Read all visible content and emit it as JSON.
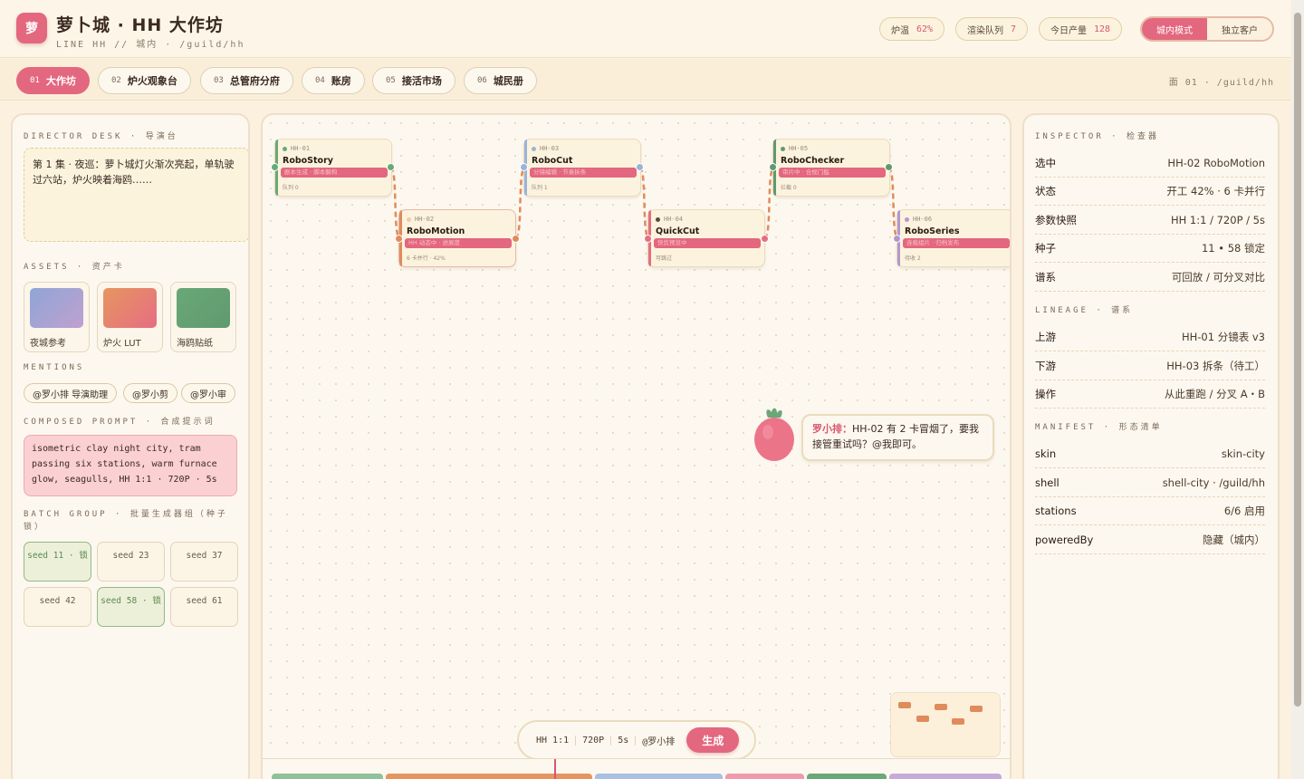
{
  "header": {
    "logo": "萝",
    "title": "萝卜城 · HH 大作坊",
    "subtitle": "LINE HH // 城内 · /guild/hh",
    "stats": [
      {
        "label": "炉温",
        "value": "62%"
      },
      {
        "label": "渲染队列",
        "value": "7"
      },
      {
        "label": "今日产量",
        "value": "128"
      }
    ],
    "mode_on": "城内模式",
    "mode_off": "独立客户"
  },
  "tabs": [
    {
      "num": "01",
      "label": "大作坊"
    },
    {
      "num": "02",
      "label": "炉火观象台"
    },
    {
      "num": "03",
      "label": "总管府分府"
    },
    {
      "num": "04",
      "label": "账房"
    },
    {
      "num": "05",
      "label": "接活市场"
    },
    {
      "num": "06",
      "label": "城民册"
    }
  ],
  "tabs_right": "面 01 · /guild/hh",
  "director": {
    "section": "DIRECTOR DESK · 导演台",
    "text": "第 1 集 · 夜巡：萝卜城灯火渐次亮起，单轨驶过六站，炉火映着海鸥……",
    "assets_section": "ASSETS · 资产卡",
    "assets": [
      {
        "label": "夜城参考",
        "color1": "#8fa6d6",
        "color2": "#bfa0d0"
      },
      {
        "label": "炉火 LUT",
        "color1": "#e79560",
        "color2": "#e56e82"
      },
      {
        "label": "海鸥贴纸",
        "color1": "#6aa877",
        "color2": "#5f9a6e"
      }
    ],
    "mentions_section": "MENTIONS",
    "mentions": [
      "@罗小排 导演助理",
      "@罗小剪",
      "@罗小审"
    ],
    "prompt_section": "COMPOSED PROMPT · 合成提示词",
    "prompt": "isometric clay night city, tram passing six stations, warm furnace glow, seagulls, HH 1:1 · 720P · 5s",
    "batch_section": "BATCH GROUP · 批量生成器组（种子锁）",
    "seeds": [
      {
        "label": "seed 11 · 锁",
        "locked": true
      },
      {
        "label": "seed 23",
        "locked": false
      },
      {
        "label": "seed 37",
        "locked": false
      },
      {
        "label": "seed 42",
        "locked": false
      },
      {
        "label": "seed 58 · 锁",
        "locked": true
      },
      {
        "label": "seed 61",
        "locked": false
      }
    ]
  },
  "nodes": [
    {
      "id": "HH-01",
      "name": "RoboStory",
      "task": "剧本生成 · 脚本解构",
      "foot": "队列 0",
      "color": "#6aa877"
    },
    {
      "id": "HH-02",
      "name": "RoboMotion",
      "task": "HH 动态中 · 进展度",
      "foot": "6 卡并行 · 42%",
      "color": "#e08b5c"
    },
    {
      "id": "HH-03",
      "name": "RoboCut",
      "task": "分镜编辑 · 节奏拆条",
      "foot": "队列 1",
      "color": "#9ab4d8"
    },
    {
      "id": "HH-04",
      "name": "QuickCut",
      "task": "快剪预览中",
      "foot": "可跳过",
      "color": "#e56e82"
    },
    {
      "id": "HH-05",
      "name": "RoboChecker",
      "task": "审片中 · 合规门槛",
      "foot": "拦截 0",
      "color": "#5f9a6e"
    },
    {
      "id": "HH-06",
      "name": "RoboSeries",
      "task": "连载组片 · 归档发布",
      "foot": "待收 2",
      "color": "#b397cd"
    }
  ],
  "chat": {
    "speaker": "罗小排：",
    "text": "HH-02 有 2 卡冒烟了，要我接管重试吗？@我即可。"
  },
  "gen_bar": {
    "ratio": "HH 1:1",
    "res": "720P",
    "dur": "5s",
    "agent": "@罗小排",
    "button": "生成"
  },
  "inspector": {
    "section": "INSPECTOR · 检查器",
    "rows": [
      {
        "k": "选中",
        "v": "HH-02 RoboMotion"
      },
      {
        "k": "状态",
        "v": "开工 42% · 6 卡并行"
      },
      {
        "k": "参数快照",
        "v": "HH 1:1 / 720P / 5s"
      },
      {
        "k": "种子",
        "v": "11 • 58 锁定"
      },
      {
        "k": "谱系",
        "v": "可回放 / 可分叉对比"
      }
    ],
    "lineage_section": "LINEAGE · 谱系",
    "lineage": [
      {
        "k": "上游",
        "v": "HH-01 分镜表 v3"
      },
      {
        "k": "下游",
        "v": "HH-03 拆条（待工）"
      },
      {
        "k": "操作",
        "v": "从此重跑 / 分叉 A・B"
      }
    ],
    "manifest_section": "MANIFEST · 形态清单",
    "manifest": [
      {
        "k": "skin",
        "v": "skin-city"
      },
      {
        "k": "shell",
        "v": "shell-city · /guild/hh"
      },
      {
        "k": "stations",
        "v": "6/6 启用"
      },
      {
        "k": "poweredBy",
        "v": "隐藏（城内）"
      }
    ]
  },
  "colors": {
    "accent": "#e3677f",
    "locked": "#5a8a55",
    "edge": "#e08b5c"
  }
}
